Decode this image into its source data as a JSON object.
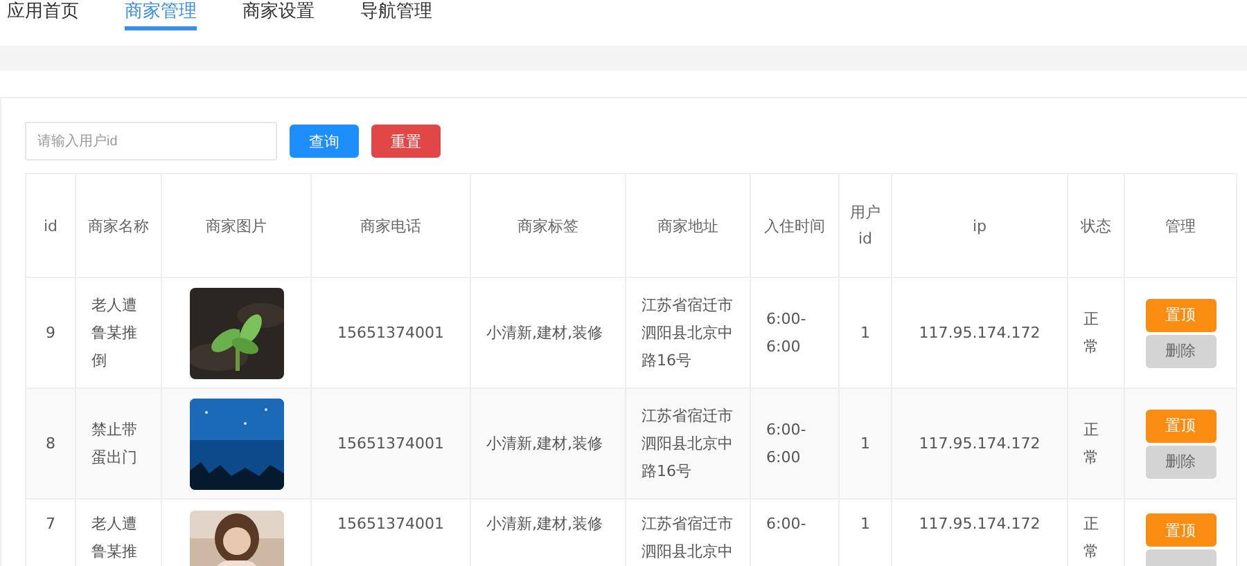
{
  "tabs": [
    {
      "label": "应用首页",
      "selected": false
    },
    {
      "label": "商家管理",
      "selected": true
    },
    {
      "label": "商家设置",
      "selected": false
    },
    {
      "label": "导航管理",
      "selected": false
    }
  ],
  "search": {
    "placeholder": "请输入用户id"
  },
  "buttons": [
    {
      "kind": "query",
      "label": "查询"
    },
    {
      "kind": "reset",
      "label": "重置"
    }
  ],
  "table": {
    "columns": [
      "id",
      "商家名称",
      "商家图片",
      "商家电话",
      "商家标签",
      "商家地址",
      "入住时间",
      "用户id",
      "ip",
      "状态",
      "管理"
    ],
    "rows": [
      {
        "id": "9",
        "name": "老人遭鲁某推倒",
        "image": {
          "kind": "picture"
        },
        "phone": "15651374001",
        "tags": "小清新,建材,装修",
        "address": "江苏省宿迁市泗阳县北京中路16号",
        "time": "6:00-6:00",
        "user_id": "1",
        "ip": "117.95.174.172",
        "status": "正常",
        "actions": [
          {
            "kind": "pin",
            "label": "置顶"
          },
          {
            "kind": "delete",
            "label": "删除"
          }
        ]
      },
      {
        "id": "8",
        "name": "禁止带蛋出门",
        "image": {
          "kind": "picture"
        },
        "phone": "15651374001",
        "tags": "小清新,建材,装修",
        "address": "江苏省宿迁市泗阳县北京中路16号",
        "time": "6:00-6:00",
        "user_id": "1",
        "ip": "117.95.174.172",
        "status": "正常",
        "actions": [
          {
            "kind": "pin",
            "label": "置顶"
          },
          {
            "kind": "delete",
            "label": "删除"
          }
        ]
      },
      {
        "id": "7",
        "name": "老人遭鲁某推",
        "image": {
          "kind": "picture"
        },
        "phone": "15651374001",
        "tags": "小清新,建材,装修",
        "address": "江苏省宿迁市泗阳县北京中",
        "time": "6:00-",
        "user_id": "1",
        "ip": "117.95.174.172",
        "status": "正常",
        "actions": [
          {
            "kind": "pin",
            "label": "置顶"
          },
          {
            "kind": "delete"
          }
        ]
      }
    ]
  }
}
